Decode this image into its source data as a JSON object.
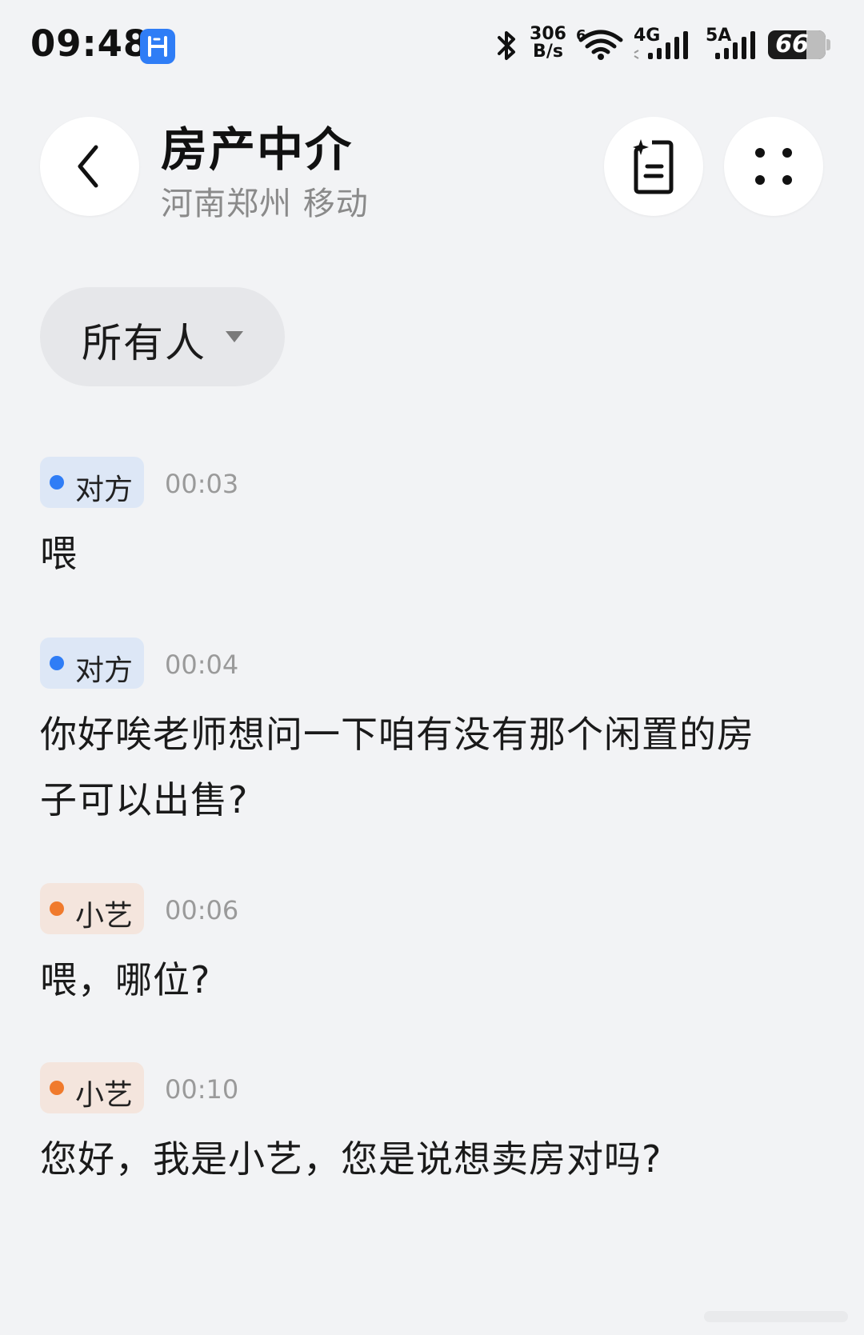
{
  "status_bar": {
    "time": "09:48",
    "net_speed_value": "306",
    "net_speed_unit": "B/s",
    "wifi_label": "6",
    "sim1_label": "4G",
    "sim2_label": "5A",
    "battery": "66",
    "battery_level": 0.66
  },
  "header": {
    "title": "房产中介",
    "subtitle": "河南郑州 移动"
  },
  "filter": {
    "label": "所有人"
  },
  "messages": [
    {
      "speaker": "对方",
      "time": "00:03",
      "text": "喂"
    },
    {
      "speaker": "对方",
      "time": "00:04",
      "text": "你好唉老师想问一下咱有没有那个闲置的房子可以出售?"
    },
    {
      "speaker": "小艺",
      "time": "00:06",
      "text": "喂，哪位?"
    },
    {
      "speaker": "小艺",
      "time": "00:10",
      "text": "您好，我是小艺，您是说想卖房对吗?"
    }
  ],
  "colors": {
    "background": "#f2f3f5",
    "other_dot": "#2f7df6",
    "ai_dot": "#f07a2c",
    "other_tag_bg": "#dde7f6",
    "ai_tag_bg": "#f4e5dd"
  }
}
